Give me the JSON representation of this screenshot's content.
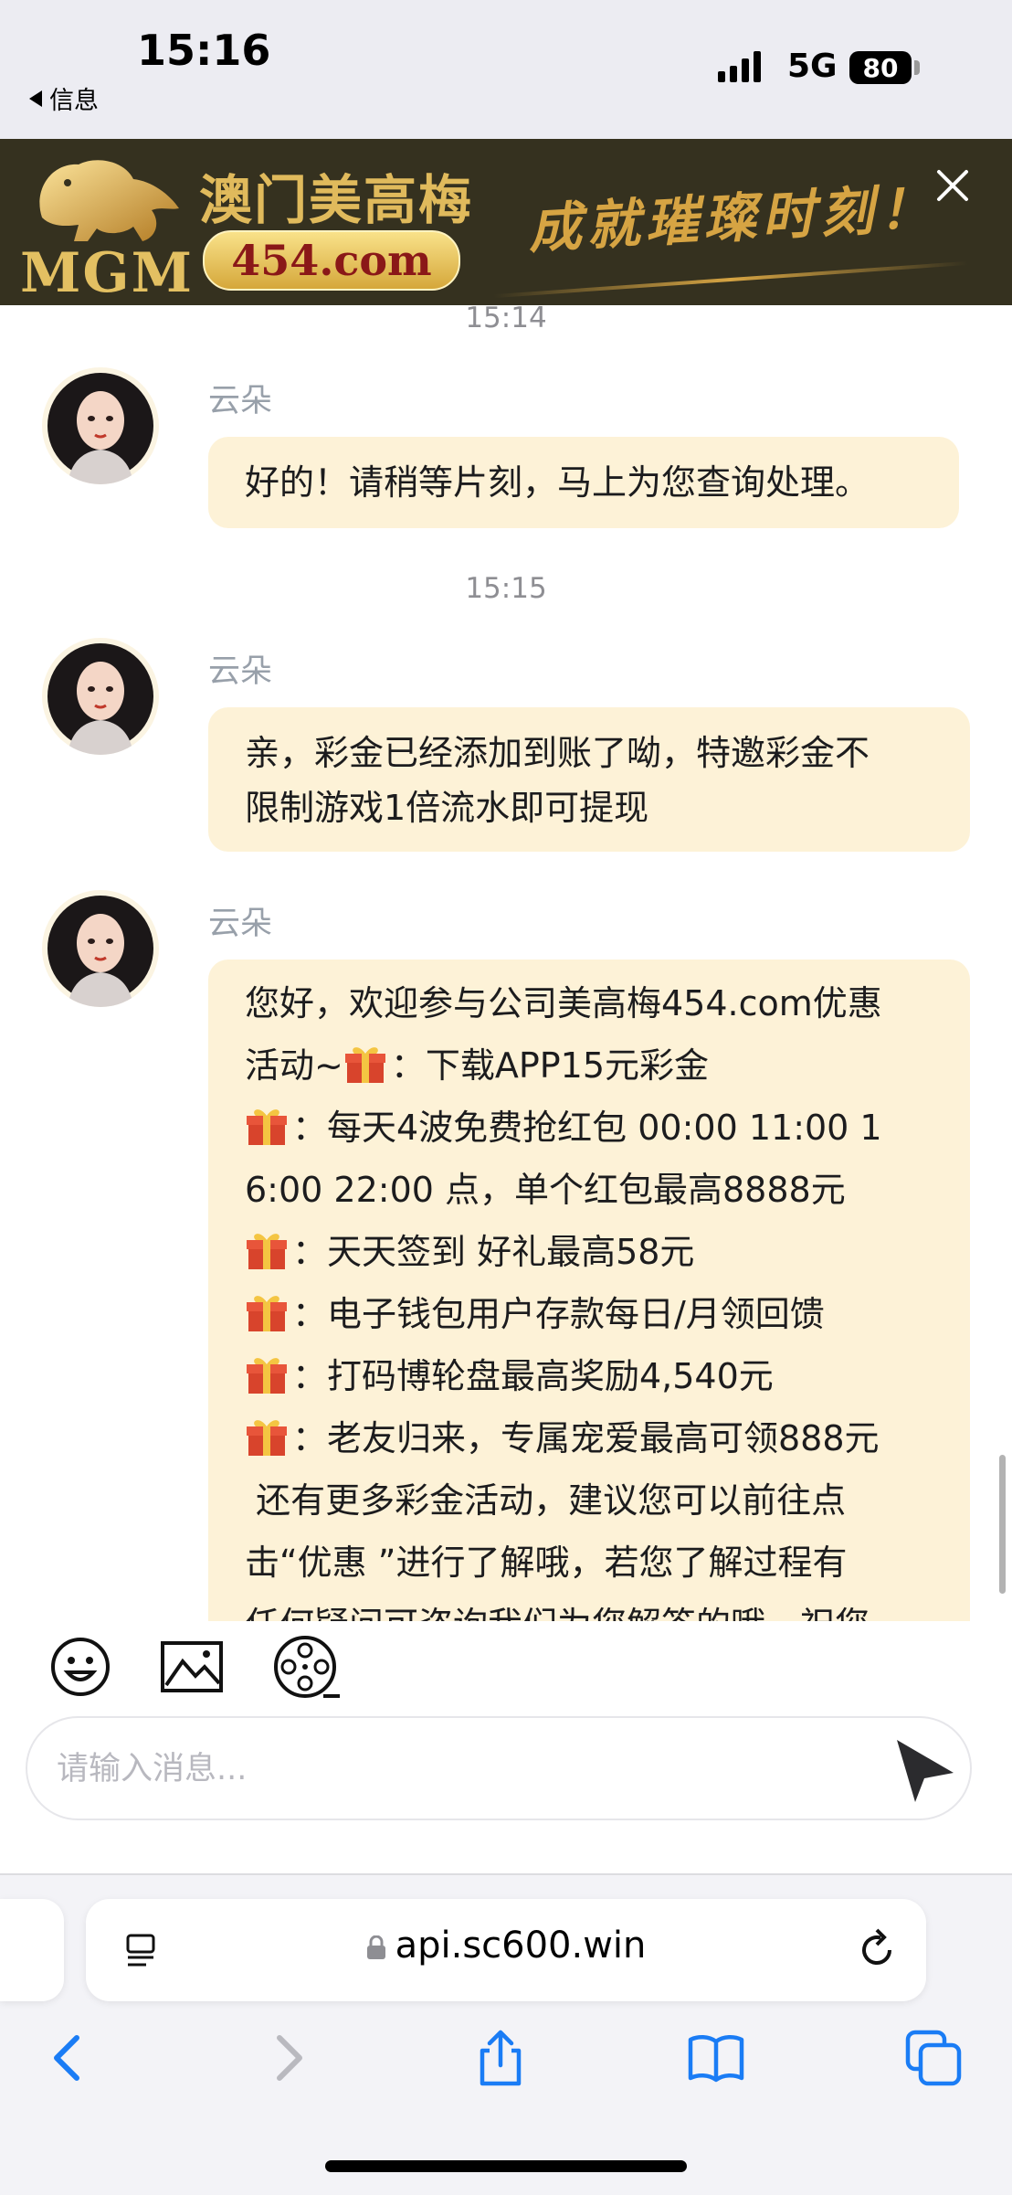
{
  "status_bar": {
    "time": "15:16",
    "back_label": "信息",
    "network": "5G",
    "battery": "80"
  },
  "banner": {
    "brand_en": "MGM",
    "brand_cn": "澳门美高梅",
    "domain": "454.com",
    "slogan": "成就璀璨时刻！",
    "close_icon": "close-icon"
  },
  "chat": {
    "timestamps": [
      "15:14",
      "15:15"
    ],
    "messages": [
      {
        "sender": "云朵",
        "text": "好的！请稍等片刻，马上为您查询处理。"
      },
      {
        "sender": "云朵",
        "lines": [
          "亲，彩金已经添加到账了呦，特邀彩金不",
          "限制游戏1倍流水即可提现"
        ]
      },
      {
        "sender": "云朵",
        "lines": [
          "您好，欢迎参与公司美高梅454.com优惠",
          "活动~",
          "：下载APP15元彩金",
          "：每天4波免费抢红包 00:00  11:00  1",
          "6:00  22:00 点，单个红包最高8888元",
          "：天天签到 好礼最高58元",
          "：电子钱包用户存款每日/月领回馈",
          "：打码博轮盘最高奖励4,540元",
          "：老友归来，专属宠爱最高可领888元",
          " 还有更多彩金活动，建议您可以前往点",
          "击“优惠 ”进行了解哦，若您了解过程有",
          "任何疑问可咨询我们为您解答的哦，祝您"
        ]
      }
    ]
  },
  "composer": {
    "tools": [
      "emoji-icon",
      "image-icon",
      "video-icon"
    ],
    "placeholder": "请输入消息...",
    "send_icon": "send-icon"
  },
  "browser": {
    "url": "api.sc600.win",
    "nav_icons": [
      "back-icon",
      "forward-icon",
      "share-icon",
      "bookmarks-icon",
      "tabs-icon"
    ]
  }
}
